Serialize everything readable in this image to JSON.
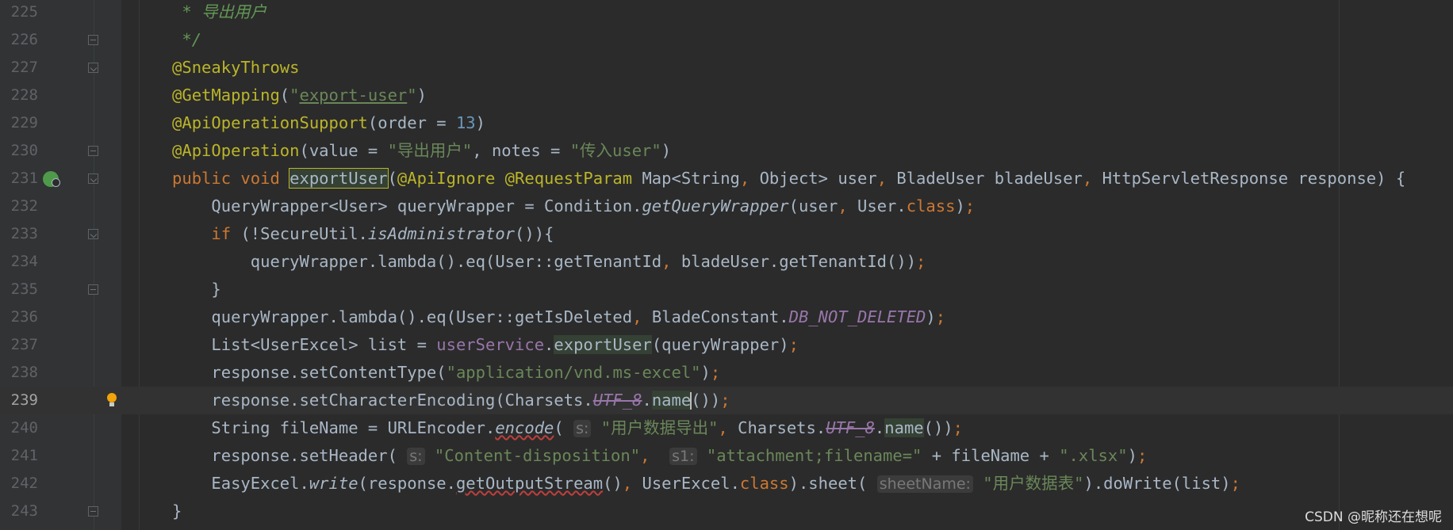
{
  "editor": {
    "lines": [
      {
        "n": "225",
        "indent": "    ",
        "tokens": [
          {
            "t": "* ",
            "c": "cmt"
          },
          {
            "t": "导出用户",
            "c": "cmt"
          }
        ]
      },
      {
        "n": "226",
        "indent": "    ",
        "tokens": [
          {
            "t": "*/",
            "c": "cmt"
          }
        ],
        "fold": "up"
      },
      {
        "n": "227",
        "indent": "   ",
        "tokens": [
          {
            "t": "@SneakyThrows",
            "c": "ann"
          }
        ],
        "fold": "down"
      },
      {
        "n": "228",
        "indent": "   ",
        "tokens": [
          {
            "t": "@GetMapping",
            "c": "ann"
          },
          {
            "t": "(",
            "c": ""
          },
          {
            "t": "\"",
            "c": "str"
          },
          {
            "t": "export-user",
            "c": "str uline-str"
          },
          {
            "t": "\"",
            "c": "str"
          },
          {
            "t": ")",
            "c": ""
          }
        ]
      },
      {
        "n": "229",
        "indent": "   ",
        "tokens": [
          {
            "t": "@ApiOperationSupport",
            "c": "ann"
          },
          {
            "t": "(order = ",
            "c": ""
          },
          {
            "t": "13",
            "c": "num"
          },
          {
            "t": ")",
            "c": ""
          }
        ]
      },
      {
        "n": "230",
        "indent": "   ",
        "tokens": [
          {
            "t": "@ApiOperation",
            "c": "ann"
          },
          {
            "t": "(value = ",
            "c": ""
          },
          {
            "t": "\"导出用户\"",
            "c": "str"
          },
          {
            "t": ", notes = ",
            "c": ""
          },
          {
            "t": "\"传入user\"",
            "c": "str"
          },
          {
            "t": ")",
            "c": ""
          }
        ],
        "fold": "up"
      },
      {
        "n": "231",
        "indent": "   ",
        "tokens": [
          {
            "t": "public void ",
            "c": "kw"
          },
          {
            "t": "exportUser",
            "c": "hl-box"
          },
          {
            "t": "(",
            "c": ""
          },
          {
            "t": "@ApiIgnore @RequestParam ",
            "c": "ann"
          },
          {
            "t": "Map<String",
            "c": ""
          },
          {
            "t": ", ",
            "c": "kw"
          },
          {
            "t": "Object> user",
            "c": ""
          },
          {
            "t": ", ",
            "c": "kw"
          },
          {
            "t": "BladeUser bladeUser",
            "c": ""
          },
          {
            "t": ", ",
            "c": "kw"
          },
          {
            "t": "HttpServletResponse response) {",
            "c": ""
          }
        ],
        "fold": "down",
        "icon": "run"
      },
      {
        "n": "232",
        "indent": "       ",
        "tokens": [
          {
            "t": "QueryWrapper<User> queryWrapper = Condition.",
            "c": ""
          },
          {
            "t": "getQueryWrapper",
            "c": "it"
          },
          {
            "t": "(user",
            "c": ""
          },
          {
            "t": ", ",
            "c": "kw"
          },
          {
            "t": "User.",
            "c": ""
          },
          {
            "t": "class",
            "c": "kw"
          },
          {
            "t": ")",
            "c": ""
          },
          {
            "t": ";",
            "c": "kw"
          }
        ]
      },
      {
        "n": "233",
        "indent": "       ",
        "tokens": [
          {
            "t": "if ",
            "c": "kw"
          },
          {
            "t": "(!SecureUtil.",
            "c": ""
          },
          {
            "t": "isAdministrator",
            "c": "it"
          },
          {
            "t": "()){",
            "c": ""
          }
        ],
        "fold": "down"
      },
      {
        "n": "234",
        "indent": "           ",
        "tokens": [
          {
            "t": "queryWrapper.lambda().eq(User::getTenantId",
            "c": ""
          },
          {
            "t": ", ",
            "c": "kw"
          },
          {
            "t": "bladeUser.getTenantId())",
            "c": ""
          },
          {
            "t": ";",
            "c": "kw"
          }
        ]
      },
      {
        "n": "235",
        "indent": "       ",
        "tokens": [
          {
            "t": "}",
            "c": ""
          }
        ],
        "fold": "up"
      },
      {
        "n": "236",
        "indent": "       ",
        "tokens": [
          {
            "t": "queryWrapper.lambda().eq(User::getIsDeleted",
            "c": ""
          },
          {
            "t": ", ",
            "c": "kw"
          },
          {
            "t": "BladeConstant.",
            "c": ""
          },
          {
            "t": "DB_NOT_DELETED",
            "c": "const"
          },
          {
            "t": ")",
            "c": ""
          },
          {
            "t": ";",
            "c": "kw"
          }
        ]
      },
      {
        "n": "237",
        "indent": "       ",
        "tokens": [
          {
            "t": "List<UserExcel> list = ",
            "c": ""
          },
          {
            "t": "userService",
            "c": "field"
          },
          {
            "t": ".",
            "c": ""
          },
          {
            "t": "exportUser",
            "c": "hl"
          },
          {
            "t": "(queryWrapper)",
            "c": ""
          },
          {
            "t": ";",
            "c": "kw"
          }
        ]
      },
      {
        "n": "238",
        "indent": "       ",
        "tokens": [
          {
            "t": "response.setContentType(",
            "c": ""
          },
          {
            "t": "\"application/vnd.ms-excel\"",
            "c": "str"
          },
          {
            "t": ")",
            "c": ""
          },
          {
            "t": ";",
            "c": "kw"
          }
        ]
      },
      {
        "n": "239",
        "indent": "       ",
        "current": true,
        "icon": "bulb",
        "tokens": [
          {
            "t": "response.setCharacterEncoding(Charsets.",
            "c": ""
          },
          {
            "t": "UTF_8",
            "c": "const strike"
          },
          {
            "t": ".",
            "c": ""
          },
          {
            "t": "name",
            "c": "hl"
          },
          {
            "t": "CARET",
            "c": "caret"
          },
          {
            "t": "()",
            "c": ""
          },
          {
            "t": ")",
            "c": ""
          },
          {
            "t": ";",
            "c": "kw"
          }
        ]
      },
      {
        "n": "240",
        "indent": "       ",
        "tokens": [
          {
            "t": "String fileName = URLEncoder.",
            "c": ""
          },
          {
            "t": "encode",
            "c": "it uline-err"
          },
          {
            "t": "( ",
            "c": ""
          },
          {
            "t": "s:",
            "c": "hint"
          },
          {
            "t": " \"用户数据导出\"",
            "c": "str"
          },
          {
            "t": ", ",
            "c": "kw"
          },
          {
            "t": "Charsets.",
            "c": ""
          },
          {
            "t": "UTF_8",
            "c": "const strike"
          },
          {
            "t": ".",
            "c": ""
          },
          {
            "t": "name",
            "c": "hl"
          },
          {
            "t": "())",
            "c": ""
          },
          {
            "t": ";",
            "c": "kw"
          }
        ]
      },
      {
        "n": "241",
        "indent": "       ",
        "tokens": [
          {
            "t": "response.setHeader( ",
            "c": ""
          },
          {
            "t": "s:",
            "c": "hint"
          },
          {
            "t": " \"Content-disposition\"",
            "c": "str"
          },
          {
            "t": ",  ",
            "c": "kw"
          },
          {
            "t": "s1:",
            "c": "hint"
          },
          {
            "t": " \"attachment;filename=\"",
            "c": "str"
          },
          {
            "t": " + fileName + ",
            "c": ""
          },
          {
            "t": "\".xlsx\"",
            "c": "str"
          },
          {
            "t": ")",
            "c": ""
          },
          {
            "t": ";",
            "c": "kw"
          }
        ]
      },
      {
        "n": "242",
        "indent": "       ",
        "tokens": [
          {
            "t": "EasyExcel.",
            "c": ""
          },
          {
            "t": "write",
            "c": "it"
          },
          {
            "t": "(response.",
            "c": ""
          },
          {
            "t": "getOutputStream",
            "c": "uline-err"
          },
          {
            "t": "()",
            "c": ""
          },
          {
            "t": ", ",
            "c": "kw"
          },
          {
            "t": "UserExcel.",
            "c": ""
          },
          {
            "t": "class",
            "c": "kw"
          },
          {
            "t": ").sheet( ",
            "c": ""
          },
          {
            "t": "sheetName:",
            "c": "hint"
          },
          {
            "t": " \"用户数据表\"",
            "c": "str"
          },
          {
            "t": ").doWrite(list)",
            "c": ""
          },
          {
            "t": ";",
            "c": "kw"
          }
        ]
      },
      {
        "n": "243",
        "indent": "   ",
        "tokens": [
          {
            "t": "}",
            "c": ""
          }
        ],
        "fold": "up"
      }
    ]
  },
  "watermark": "CSDN @昵称还在想呢"
}
